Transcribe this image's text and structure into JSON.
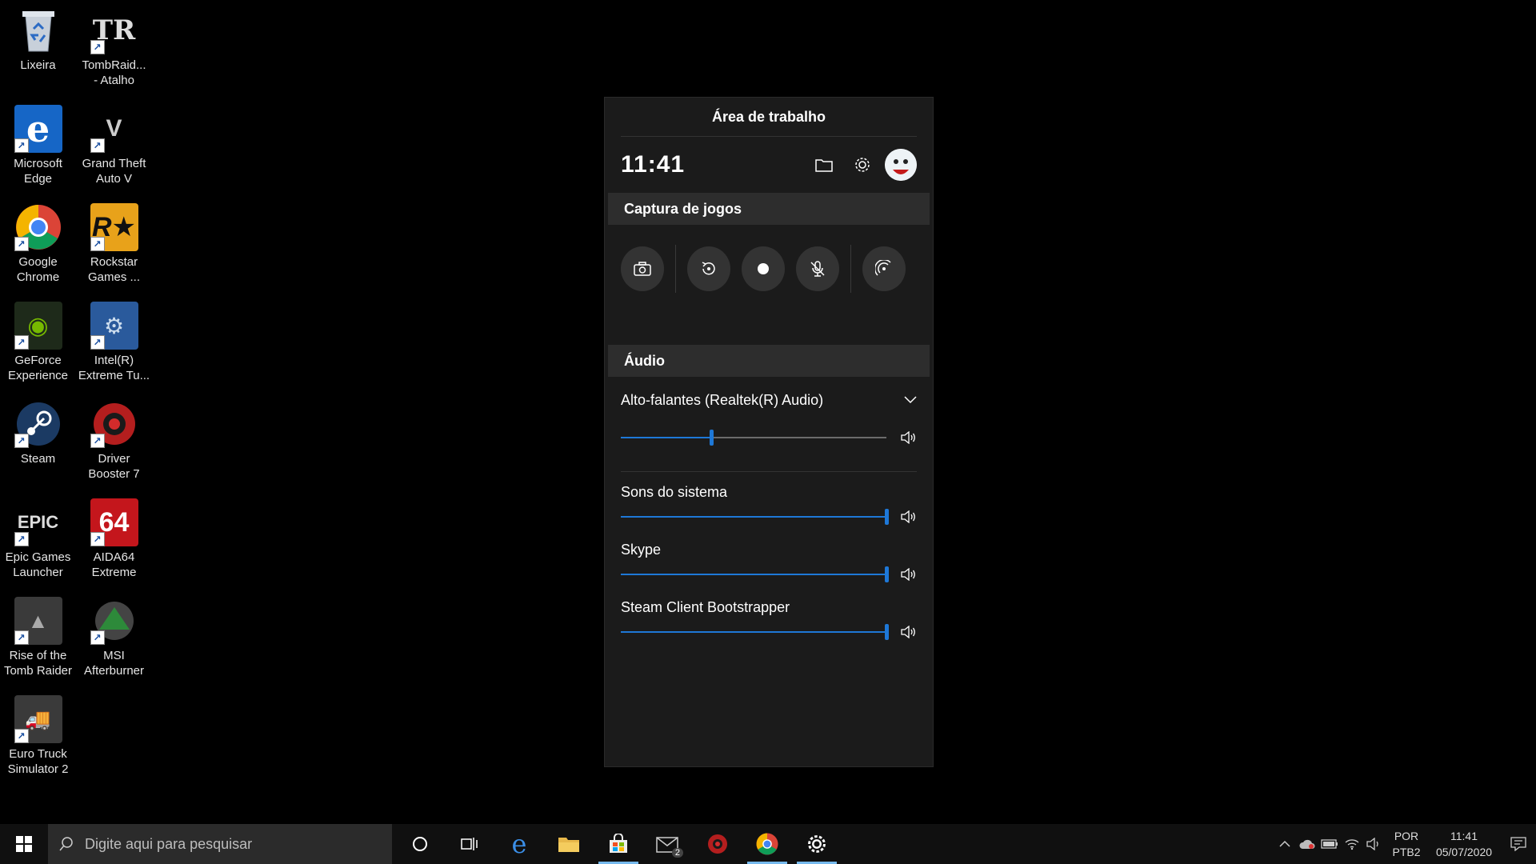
{
  "desktop": {
    "icons": [
      {
        "label": "Lixeira"
      },
      {
        "label": "TombRaid...\n- Atalho"
      },
      {
        "label": "Microsoft\nEdge"
      },
      {
        "label": "Grand Theft\nAuto V"
      },
      {
        "label": "Google\nChrome"
      },
      {
        "label": "Rockstar\nGames ..."
      },
      {
        "label": "GeForce\nExperience"
      },
      {
        "label": "Intel(R)\nExtreme Tu..."
      },
      {
        "label": "Steam"
      },
      {
        "label": "Driver\nBooster 7"
      },
      {
        "label": "Epic Games\nLauncher"
      },
      {
        "label": "AIDA64\nExtreme"
      },
      {
        "label": "Rise of the\nTomb Raider"
      },
      {
        "label": "MSI\nAfterburner"
      },
      {
        "label": "Euro Truck\nSimulator 2"
      }
    ]
  },
  "gamebar": {
    "title": "Área de trabalho",
    "clock": "11:41",
    "capture": {
      "heading": "Captura de jogos"
    },
    "audio": {
      "heading": "Áudio",
      "device": "Alto-falantes (Realtek(R) Audio)",
      "device_volume": 0.34,
      "apps": [
        {
          "name": "Sons do sistema",
          "volume": 1.0
        },
        {
          "name": "Skype",
          "volume": 1.0
        },
        {
          "name": "Steam Client Bootstrapper",
          "volume": 1.0
        }
      ]
    }
  },
  "taskbar": {
    "search_placeholder": "Digite aqui para pesquisar",
    "mail_badge": "2",
    "lang_top": "POR",
    "lang_bottom": "PTB2",
    "time": "11:41",
    "date": "05/07/2020"
  },
  "colors": {
    "accent": "#1e78d7",
    "panel": "#1b1b1b",
    "section": "#2d2d2d",
    "taskbar": "#101010"
  }
}
